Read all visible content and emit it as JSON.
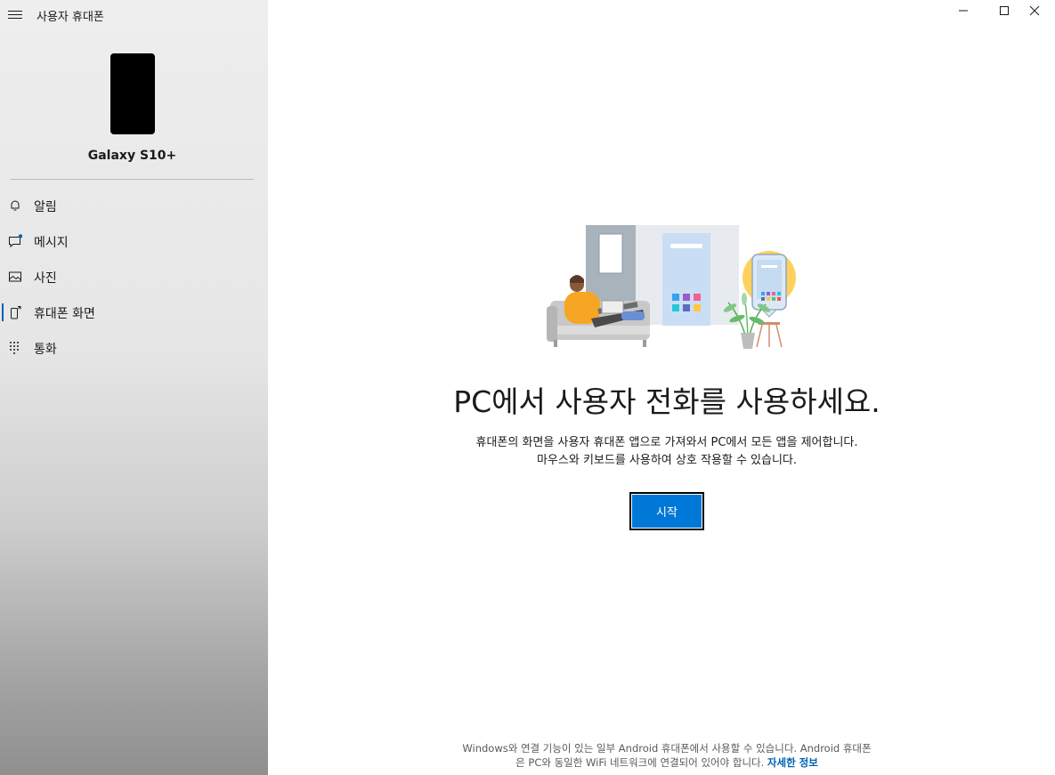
{
  "app": {
    "title": "사용자 휴대폰"
  },
  "device": {
    "name": "Galaxy S10+"
  },
  "nav": [
    {
      "label": "알림",
      "icon": "bell-icon"
    },
    {
      "label": "메시지",
      "icon": "message-icon"
    },
    {
      "label": "사진",
      "icon": "photo-icon"
    },
    {
      "label": "휴대폰 화면",
      "icon": "phone-screen-icon",
      "selected": true
    },
    {
      "label": "통화",
      "icon": "dialpad-icon"
    }
  ],
  "main": {
    "headline": "PC에서 사용자 전화를 사용하세요.",
    "desc_line1": "휴대폰의 화면을 사용자 휴대폰 앱으로 가져와서 PC에서 모든 앱을 제어합니다.",
    "desc_line2": "마우스와 키보드를 사용하여 상호 작용할 수 있습니다.",
    "start_label": "시작",
    "footer_line1": "Windows와 연결 기능이 있는 일부 Android 휴대폰에서 사용할 수 있습니다. Android 휴대폰",
    "footer_line2": "은 PC와 동일한 WiFi 네트워크에 연결되어 있어야 합니다.",
    "footer_link": "자세한 정보"
  },
  "colors": {
    "accent": "#0078d7",
    "link": "#0063b1",
    "illustration_yellow": "#ffd15c",
    "illustration_orange": "#f6a623"
  }
}
